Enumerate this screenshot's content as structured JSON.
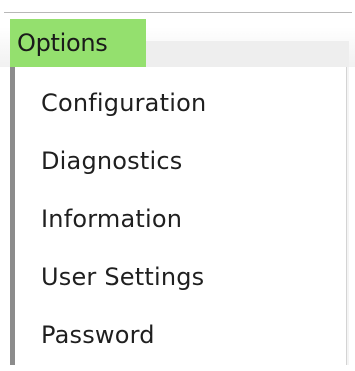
{
  "menu": {
    "title": "Options",
    "items": [
      {
        "label": "Configuration"
      },
      {
        "label": "Diagnostics"
      },
      {
        "label": "Information"
      },
      {
        "label": "User Settings"
      },
      {
        "label": "Password"
      }
    ]
  },
  "colors": {
    "highlight": "#94e06e",
    "menu_border": "#8c8c8c",
    "text": "#1f1f1f"
  }
}
